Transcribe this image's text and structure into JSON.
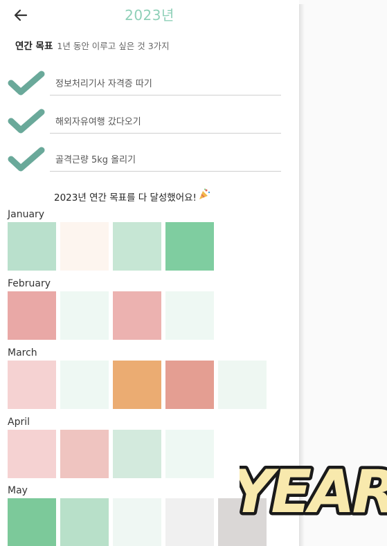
{
  "header": {
    "title": "2023년",
    "back_icon": "arrow-left-icon"
  },
  "goals_section": {
    "title": "연간 목표",
    "description": "1년 동안 이루고 싶은 것 3가지",
    "goals": [
      {
        "label": "정보처리기사 자격증 따기",
        "checked": true
      },
      {
        "label": "해외자유여행 갔다오기",
        "checked": true
      },
      {
        "label": "골격근량 5kg 올리기",
        "checked": true
      }
    ],
    "completion_message": "2023년 연간 목표를 다 달성했어요!",
    "completion_icon": "party-popper-icon"
  },
  "months": [
    {
      "name": "January",
      "tiles": [
        "#b9e0cc",
        "#fdf5ef",
        "#c6e6d4",
        "#7fcda0"
      ]
    },
    {
      "name": "February",
      "tiles": [
        "#e9a8a6",
        "#eef8f3",
        "#ecb2b0",
        "#eef8f3"
      ]
    },
    {
      "name": "March",
      "tiles": [
        "#f5d2d2",
        "#eef8f3",
        "#ebac72",
        "#e49e92",
        "#eef7f2"
      ]
    },
    {
      "name": "April",
      "tiles": [
        "#f5d2d2",
        "#efc4c0",
        "#d3eadd",
        "#eef8f3"
      ]
    },
    {
      "name": "May",
      "tiles": [
        "#7cc99a",
        "#b8e0c9",
        "#eff7f3",
        "#f0f0f0",
        "#dad7d6"
      ]
    }
  ],
  "stamp_text": "YEAR",
  "colors": {
    "accent": "#8fd0b8",
    "check": "#6aa99a",
    "stamp_fill": "#f8e9ad",
    "stamp_outline": "#1a1a1a"
  }
}
